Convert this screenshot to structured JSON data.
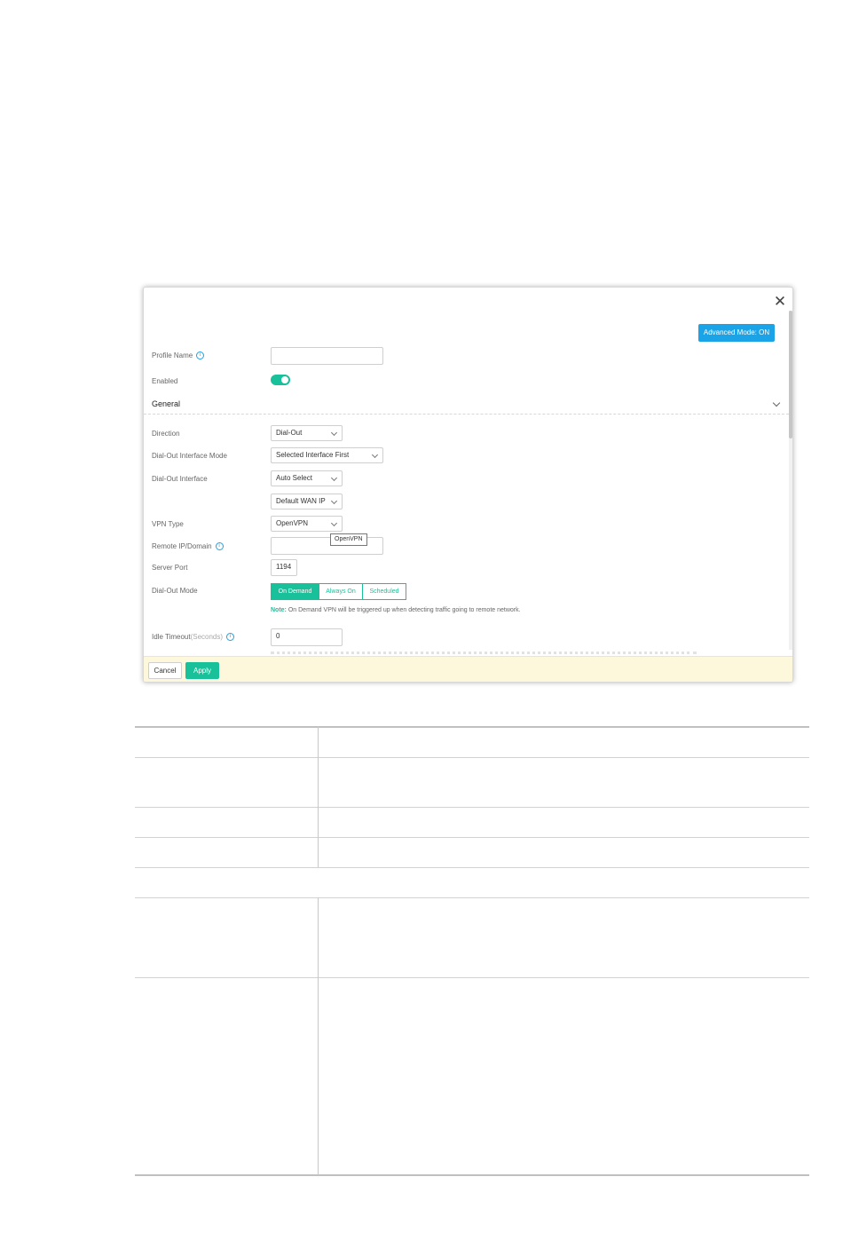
{
  "dialog": {
    "close_glyph": "✕",
    "advanced_mode_label": "Advanced Mode: ON",
    "fields": {
      "profile_name_label": "Profile Name",
      "profile_name_value": "",
      "enabled_label": "Enabled",
      "enabled_on": true,
      "direction_label": "Direction",
      "direction_value": "Dial-Out",
      "dialout_interface_mode_label": "Dial-Out Interface Mode",
      "dialout_interface_mode_value": "Selected Interface First",
      "dialout_interface_label": "Dial-Out Interface",
      "dialout_interface_value": "Auto Select",
      "wan_ip_value": "Default WAN IP",
      "vpn_type_label": "VPN Type",
      "vpn_type_value": "OpenVPN",
      "vpn_type_tooltip": "OpenVPN",
      "remote_label": "Remote IP/Domain",
      "remote_value": "",
      "server_port_label": "Server Port",
      "server_port_value": "1194",
      "dialout_mode_label": "Dial-Out Mode",
      "dialout_mode_options": [
        "On Demand",
        "Always On",
        "Scheduled"
      ],
      "dialout_mode_selected": "On Demand",
      "note_key": "Note:",
      "note_text": " On Demand VPN will be triggered up when detecting traffic going to remote network.",
      "idle_timeout_label": "Idle Timeout",
      "idle_timeout_unit": "(Seconds)",
      "idle_timeout_value": "0"
    },
    "section_general": "General",
    "footer": {
      "cancel_label": "Cancel",
      "apply_label": "Apply"
    }
  },
  "colors": {
    "accent_green": "#19c19a",
    "accent_blue": "#1ba3e8",
    "footer_bg": "#fdf7dc"
  },
  "icons": [
    "close-icon",
    "info-icon",
    "chevron-down-icon"
  ]
}
